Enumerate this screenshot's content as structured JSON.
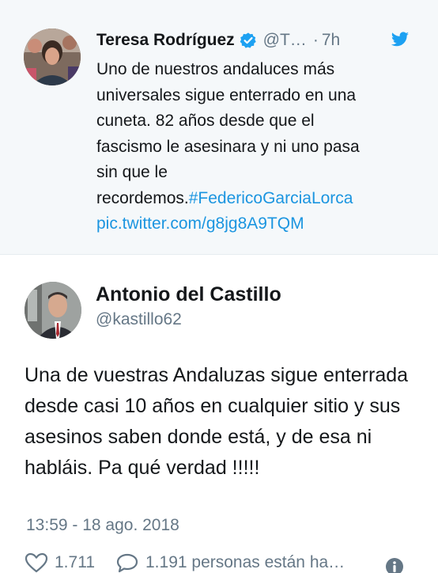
{
  "quoted_tweet": {
    "author_name": "Teresa Rodríguez",
    "handle": "@T…",
    "separator": "·",
    "time": "7h",
    "text_lines": [
      "Uno de nuestros andaluces más",
      "universales sigue enterrado en una",
      "cuneta. 82 años desde que el",
      "fascismo le asesinara y ni uno pasa",
      "sin que le"
    ],
    "text_last_prefix": "recordemos.",
    "hashtag": "#FedericoGarciaLorca",
    "pic_link": "pic.twitter.com/g8jg8A9TQM",
    "verified_icon": "verified-badge-icon",
    "bird_icon": "twitter-bird-icon",
    "link_color": "#1b95e0"
  },
  "reply_tweet": {
    "author_name": "Antonio del Castillo",
    "handle": "@kastillo62",
    "text": "Una de vuestras Andaluzas sigue enterrada desde casi 10 años en cualquier sitio y sus asesinos saben donde está, y de esa ni habláis. Pa qué verdad !!!!!",
    "timestamp": "13:59 - 18 ago. 2018"
  },
  "actions": {
    "likes": "1.711",
    "replies_text": "1.191 personas están ha…",
    "like_icon": "heart-icon",
    "reply_icon": "comment-bubble-icon",
    "info_icon": "info-icon"
  }
}
